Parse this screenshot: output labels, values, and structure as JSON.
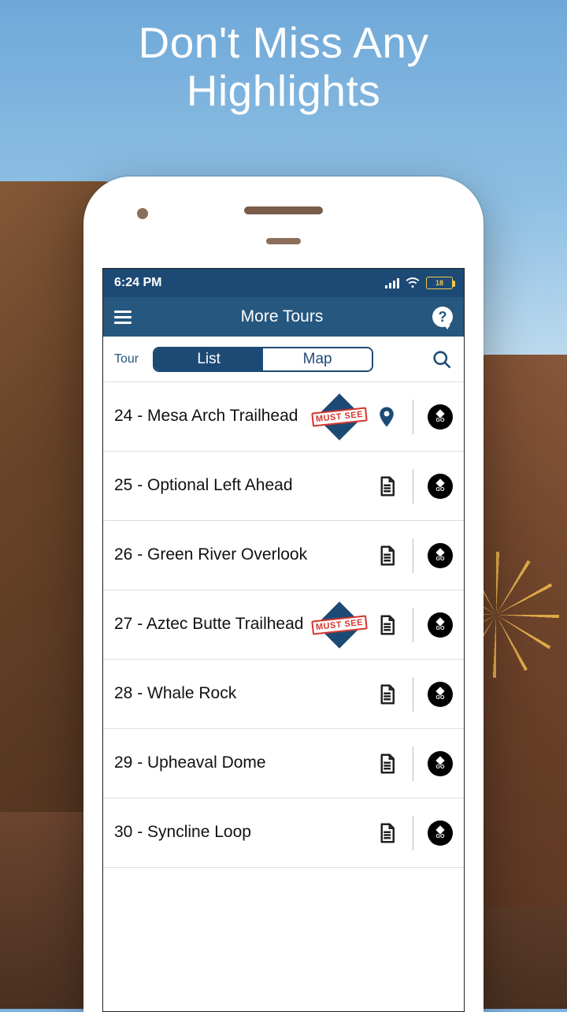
{
  "promo": {
    "headline_line1": "Don't Miss Any",
    "headline_line2": "Highlights"
  },
  "statusbar": {
    "time": "6:24 PM",
    "battery_pct": "18"
  },
  "appbar": {
    "title": "More Tours",
    "help_glyph": "?"
  },
  "subheader": {
    "tour_label": "Tour",
    "seg_list": "List",
    "seg_map": "Map"
  },
  "badges": {
    "must_see": "MUST SEE"
  },
  "go_button": {
    "label": "GO"
  },
  "items": [
    {
      "title": "24 - Mesa Arch Trailhead",
      "must_see": true,
      "pin": true,
      "doc": false
    },
    {
      "title": "25 - Optional Left Ahead",
      "must_see": false,
      "pin": false,
      "doc": true
    },
    {
      "title": "26 - Green River Overlook",
      "must_see": false,
      "pin": false,
      "doc": true
    },
    {
      "title": "27 - Aztec Butte Trailhead",
      "must_see": true,
      "pin": false,
      "doc": true
    },
    {
      "title": "28 - Whale Rock",
      "must_see": false,
      "pin": false,
      "doc": true
    },
    {
      "title": "29 - Upheaval Dome",
      "must_see": false,
      "pin": false,
      "doc": true
    },
    {
      "title": "30 - Syncline Loop",
      "must_see": false,
      "pin": false,
      "doc": true
    }
  ]
}
